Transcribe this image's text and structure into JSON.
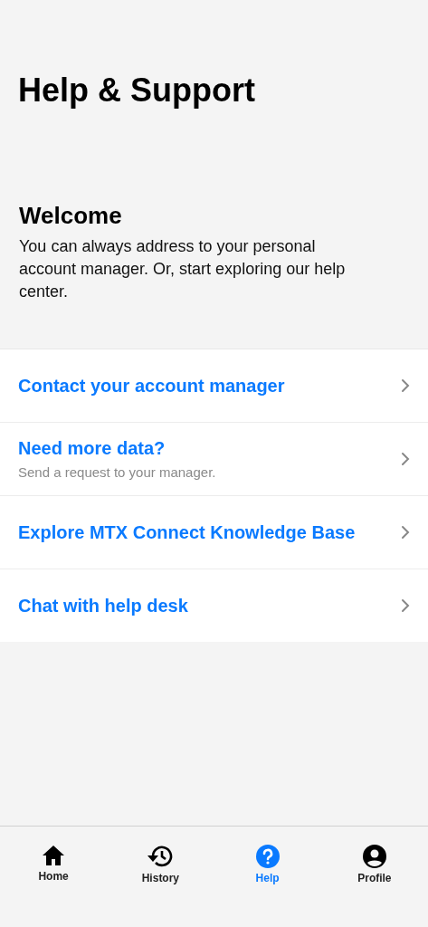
{
  "title": "Help & Support",
  "welcome": {
    "heading": "Welcome",
    "text": "You can always address to your personal account manager. Or, start exploring our help center."
  },
  "items": [
    {
      "label": "Contact your account manager"
    },
    {
      "label": "Need more data?",
      "subtitle": "Send a request to your manager."
    },
    {
      "label": "Explore MTX Connect Knowledge Base"
    },
    {
      "label": "Chat with help desk"
    }
  ],
  "tabs": [
    {
      "label": "Home",
      "selected": false
    },
    {
      "label": "History",
      "selected": false
    },
    {
      "label": "Help",
      "selected": true
    },
    {
      "label": "Profile",
      "selected": false
    }
  ]
}
